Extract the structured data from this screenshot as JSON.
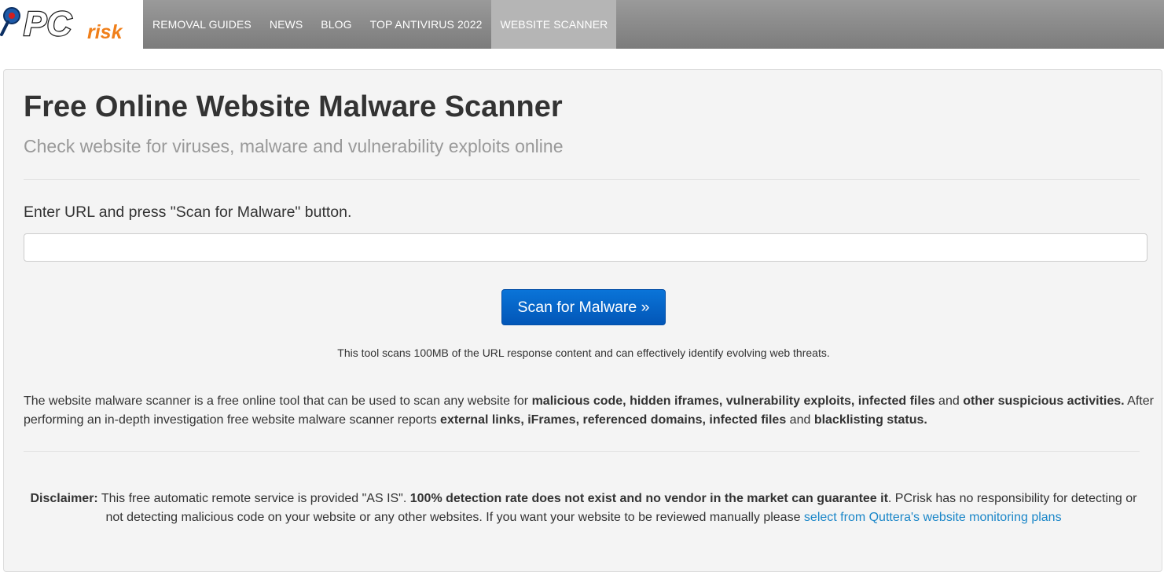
{
  "header": {
    "logo_text": "PCrisk",
    "nav": [
      {
        "label": "REMOVAL GUIDES"
      },
      {
        "label": "NEWS"
      },
      {
        "label": "BLOG"
      },
      {
        "label": "TOP ANTIVIRUS 2022"
      },
      {
        "label": "WEBSITE SCANNER",
        "active": true
      }
    ],
    "colors": {
      "bar": "#888888",
      "active_tab": "#b5b5b5"
    }
  },
  "main": {
    "title": "Free Online Website Malware Scanner",
    "subtitle": "Check website for viruses, malware and vulnerability exploits online",
    "url_label": "Enter URL and press \"Scan for Malware\" button.",
    "url_value": "",
    "url_placeholder": "",
    "scan_button": "Scan for Malware »",
    "note": "This tool scans 100MB of the URL response content and can effectively identify evolving web threats.",
    "description": {
      "t1": "The website malware scanner is a free online tool that can be used to scan any website for ",
      "b1": "malicious code, hidden iframes, vulnerability exploits, infected files",
      "t2": " and ",
      "b2": "other suspicious activities.",
      "t3": " After performing an in-depth investigation free website malware scanner reports ",
      "b3": "external links, iFrames, referenced domains, infected files",
      "t4": " and ",
      "b4": "blacklisting status."
    },
    "disclaimer": {
      "label": "Disclaimer:",
      "t1": " This free automatic remote service is provided \"AS IS\". ",
      "b1": "100% detection rate does not exist and no vendor in the market can guarantee it",
      "t2": ". PCrisk has no responsibility for detecting or not detecting malicious code on your website or any other websites. If you want your website to be reviewed manually please ",
      "link": "select from Quttera's website monitoring plans"
    },
    "colors": {
      "button": "#0a6ccf",
      "link": "#1a86c8",
      "subtitle": "#999999"
    }
  }
}
